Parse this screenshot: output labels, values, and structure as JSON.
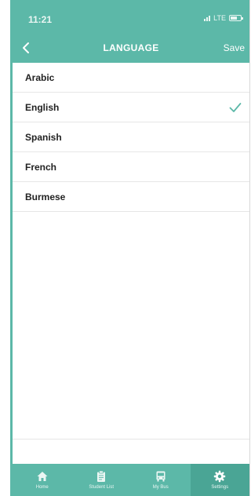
{
  "status_bar": {
    "time": "11:21",
    "network": "LTE"
  },
  "header": {
    "title": "LANGUAGE",
    "save_label": "Save"
  },
  "languages": [
    {
      "label": "Arabic",
      "selected": false
    },
    {
      "label": "English",
      "selected": true
    },
    {
      "label": "Spanish",
      "selected": false
    },
    {
      "label": "French",
      "selected": false
    },
    {
      "label": "Burmese",
      "selected": false
    }
  ],
  "tab_bar": {
    "tabs": [
      {
        "label": "Home",
        "icon": "home-icon"
      },
      {
        "label": "Student List",
        "icon": "clipboard-icon"
      },
      {
        "label": "My Bus",
        "icon": "bus-icon"
      },
      {
        "label": "Settings",
        "icon": "gear-icon",
        "active": true
      }
    ]
  },
  "colors": {
    "accent": "#5cb8a8",
    "active_tab": "#4aa595",
    "checkmark": "#5cb8a8"
  }
}
